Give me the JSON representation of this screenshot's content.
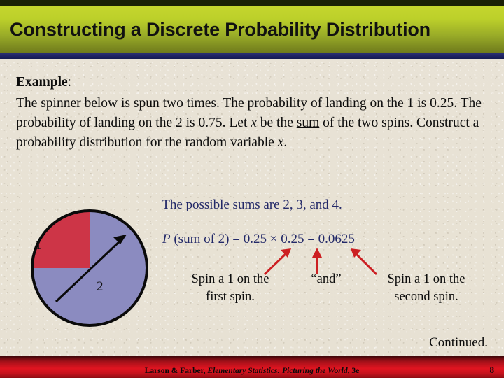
{
  "slide": {
    "title": "Constructing a Discrete Probability Distribution",
    "example_label": "Example",
    "example_colon": ":",
    "paragraph": {
      "part1": "The spinner below is spun two times.  The probability of landing on the 1 is 0.25.  The probability of landing on the 2 is 0.75.  Let ",
      "var1": "x",
      "part2": " be the ",
      "underlined": "sum",
      "part3": " of the two spins.  Construct a probability distribution for the random variable ",
      "var2": "x",
      "part4": "."
    },
    "possible_sums": "The possible sums are 2, 3, and 4.",
    "equation": {
      "p": "P",
      "rest": " (sum of 2) = 0.25 ×  0.25 = 0.0625"
    },
    "spinner": {
      "slice_1_label": "1",
      "slice_2_label": "2",
      "slice_1_color": "#cd3547",
      "slice_2_color": "#8b8bc0",
      "outline_color": "#0a0a0a",
      "needle_color": "#0a0a0a",
      "slice_1_fraction": 0.25,
      "slice_2_fraction": 0.75
    },
    "captions": {
      "first_spin_line1": "Spin a 1 on the",
      "first_spin_line2": "first spin.",
      "and": "“and”",
      "second_spin_line1": "Spin a 1 on the",
      "second_spin_line2": "second spin."
    },
    "arrow_color": "#cc1f22",
    "continued": "Continued.",
    "footer": {
      "authors": "Larson & Farber, ",
      "book_title": "Elementary Statistics: Picturing the World",
      "edition": ", 3e",
      "page_number": "8"
    },
    "colors": {
      "title_gradient_top": "#c5d62e",
      "title_gradient_bottom": "#6e7a1c",
      "title_underline": "#1b2060",
      "background": "#e8e2d5",
      "heading_text": "#232968",
      "footer_red": "#e01420"
    }
  }
}
